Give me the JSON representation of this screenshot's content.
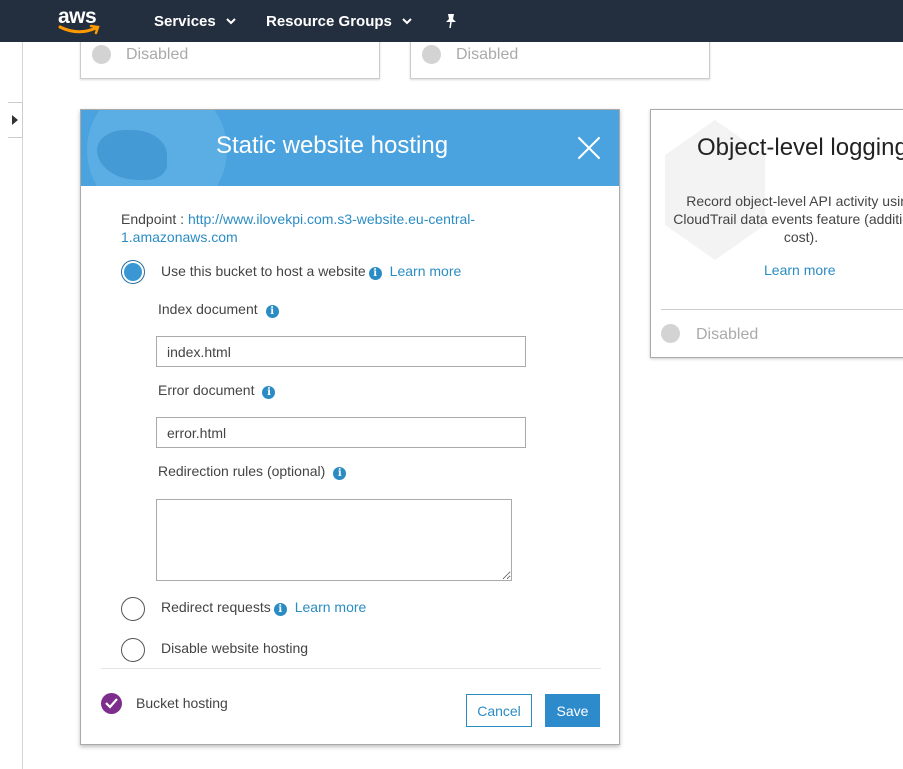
{
  "topnav": {
    "logo": "aws",
    "services_label": "Services",
    "resource_groups_label": "Resource Groups",
    "chevron": "⌄",
    "pin_icon": "pin-icon"
  },
  "top_cards": [
    {
      "status": "Disabled"
    },
    {
      "status": "Disabled"
    }
  ],
  "modal": {
    "title": "Static website hosting",
    "endpoint_label": "Endpoint : ",
    "endpoint_url": "http://www.ilovekpi.com.s3-website.eu-central-1.amazonaws.com",
    "options": [
      {
        "label": "Use this bucket to host a website",
        "learn_more": "Learn more",
        "selected": true
      },
      {
        "label": "Redirect requests",
        "learn_more": "Learn more",
        "selected": false
      },
      {
        "label": "Disable website hosting",
        "selected": false
      }
    ],
    "index_document": {
      "label": "Index document",
      "value": "index.html"
    },
    "error_document": {
      "label": "Error document",
      "value": "error.html"
    },
    "redirection_rules": {
      "label": "Redirection rules (optional)",
      "value": ""
    },
    "footer_label": "Bucket hosting",
    "cancel_label": "Cancel",
    "save_label": "Save"
  },
  "logging_card": {
    "title": "Object-level logging",
    "description": "Record object-level API activity using CloudTrail data events feature (additional cost).",
    "learn_more": "Learn more",
    "status": "Disabled"
  },
  "colors": {
    "nav_bg": "#232f3e",
    "header_blue": "#4aa3df",
    "link_blue": "#2b8cc4",
    "check_purple": "#7d2d8c"
  }
}
